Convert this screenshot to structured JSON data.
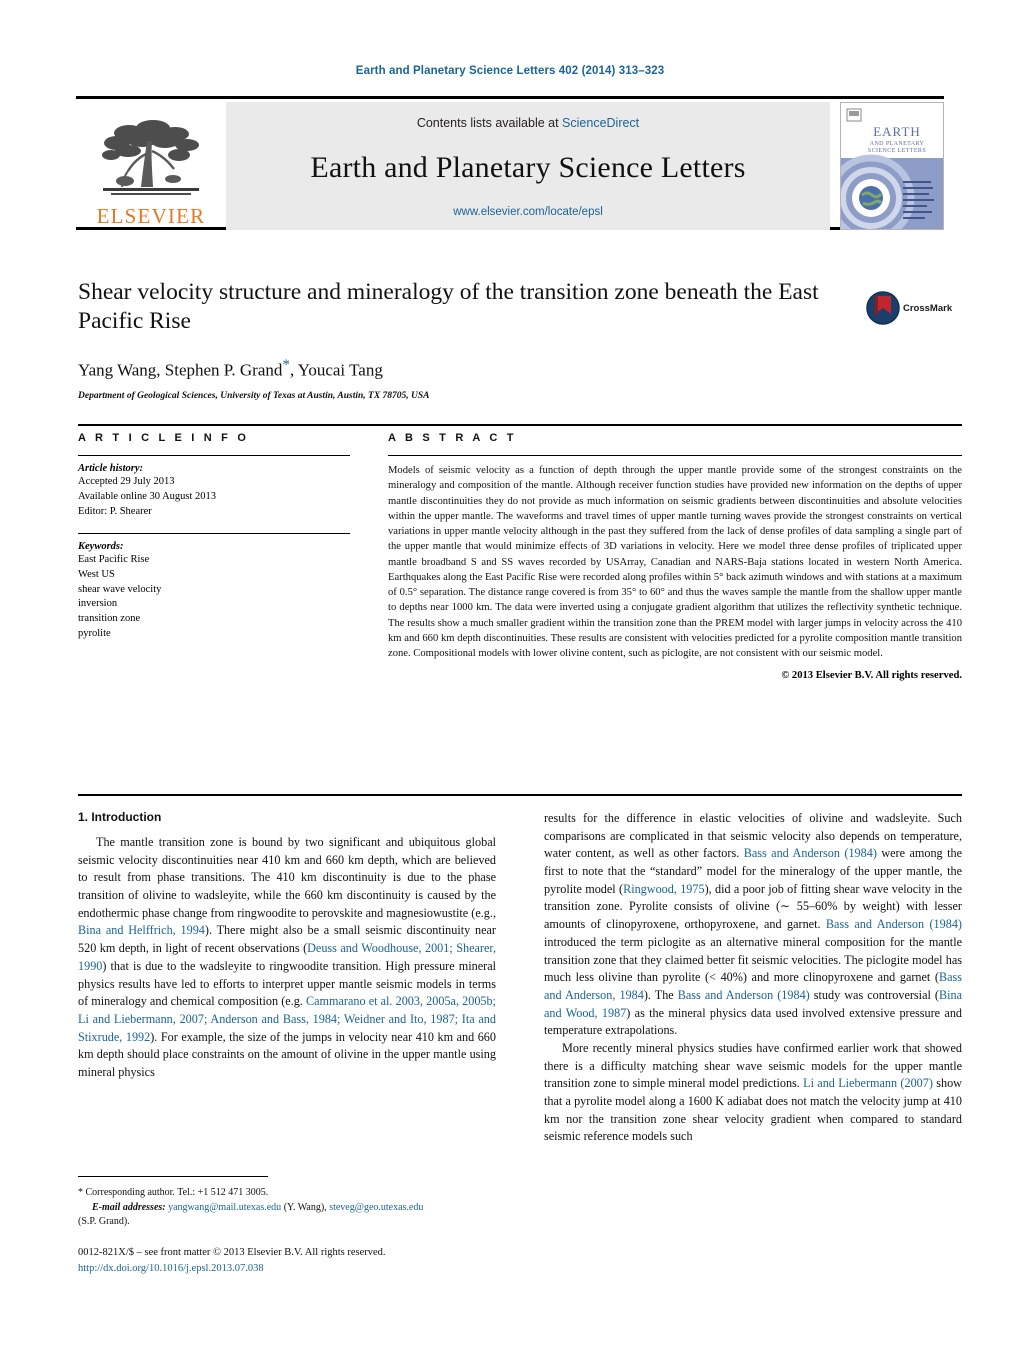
{
  "running_head": "Earth and Planetary Science Letters 402 (2014) 313–323",
  "masthead": {
    "publisher": "ELSEVIER",
    "contents_prefix": "Contents lists available at ",
    "sciencedirect": "ScienceDirect",
    "journal_title": "Earth and Planetary Science Letters",
    "journal_url": "www.elsevier.com/locate/epsl",
    "cover_title_line1": "EARTH",
    "cover_title_line2": "AND PLANETARY",
    "cover_title_line3": "SCIENCE LETTERS"
  },
  "article": {
    "title": "Shear velocity structure and mineralogy of the transition zone beneath the East Pacific Rise",
    "authors": "Yang Wang, Stephen P. Grand",
    "authors_tail": ", Youcai Tang",
    "corresponding_marker": "*",
    "affiliation": "Department of Geological Sciences, University of Texas at Austin, Austin, TX 78705, USA",
    "crossmark_label": "CrossMark"
  },
  "info": {
    "heading": "A R T I C L E    I N F O",
    "history_label": "Article history:",
    "history": [
      "Accepted 29 July 2013",
      "Available online 30 August 2013",
      "Editor: P. Shearer"
    ],
    "keywords_label": "Keywords:",
    "keywords": [
      "East Pacific Rise",
      "West US",
      "shear wave velocity",
      "inversion",
      "transition zone",
      "pyrolite"
    ]
  },
  "abstract": {
    "heading": "A B S T R A C T",
    "text": "Models of seismic velocity as a function of depth through the upper mantle provide some of the strongest constraints on the mineralogy and composition of the mantle. Although receiver function studies have provided new information on the depths of upper mantle discontinuities they do not provide as much information on seismic gradients between discontinuities and absolute velocities within the upper mantle. The waveforms and travel times of upper mantle turning waves provide the strongest constraints on vertical variations in upper mantle velocity although in the past they suffered from the lack of dense profiles of data sampling a single part of the upper mantle that would minimize effects of 3D variations in velocity. Here we model three dense profiles of triplicated upper mantle broadband S and SS waves recorded by USArray, Canadian and NARS-Baja stations located in western North America. Earthquakes along the East Pacific Rise were recorded along profiles within 5° back azimuth windows and with stations at a maximum of 0.5° separation. The distance range covered is from 35° to 60° and thus the waves sample the mantle from the shallow upper mantle to depths near 1000 km. The data were inverted using a conjugate gradient algorithm that utilizes the reflectivity synthetic technique. The results show a much smaller gradient within the transition zone than the PREM model with larger jumps in velocity across the 410 km and 660 km depth discontinuities. These results are consistent with velocities predicted for a pyrolite composition mantle transition zone. Compositional models with lower olivine content, such as piclogite, are not consistent with our seismic model.",
    "copyright": "© 2013 Elsevier B.V. All rights reserved."
  },
  "body": {
    "section_heading": "1. Introduction",
    "left_paragraph_1": "The mantle transition zone is bound by two significant and ubiquitous global seismic velocity discontinuities near 410 km and 660 km depth, which are believed to result from phase transitions. The 410 km discontinuity is due to the phase transition of olivine to wadsleyite, while the 660 km discontinuity is caused by the endothermic phase change from ringwoodite to perovskite and magnesiowustite (e.g., ",
    "left_ref_1": "Bina and Helffrich, 1994",
    "left_paragraph_1b": "). There might also be a small seismic discontinuity near 520 km depth, in light of recent observations (",
    "left_ref_2": "Deuss and Woodhouse, 2001; Shearer, 1990",
    "left_paragraph_1c": ") that is due to the wadsleyite to ringwoodite transition. High pressure mineral physics results have led to efforts to interpret upper mantle seismic models in terms of mineralogy and chemical composition (e.g. ",
    "left_ref_3": "Cammarano et al. 2003, 2005a, 2005b; Li and Liebermann, 2007; Anderson and Bass, 1984; Weidner and Ito, 1987; Ita and Stixrude, 1992",
    "left_paragraph_1d": "). For example, the size of the jumps in velocity near 410 km and 660 km depth should place constraints on the amount of olivine in the upper mantle using mineral physics",
    "right_paragraph_1a": "results for the difference in elastic velocities of olivine and wadsleyite. Such comparisons are complicated in that seismic velocity also depends on temperature, water content, as well as other factors. ",
    "right_ref_1": "Bass and Anderson (1984)",
    "right_paragraph_1b": " were among the first to note that the “standard” model for the mineralogy of the upper mantle, the pyrolite model (",
    "right_ref_2": "Ringwood, 1975",
    "right_paragraph_1c": "), did a poor job of fitting shear wave velocity in the transition zone. Pyrolite consists of olivine (∼ 55–60% by weight) with lesser amounts of clinopyroxene, orthopyroxene, and garnet. ",
    "right_ref_3": "Bass and Anderson (1984)",
    "right_paragraph_1d": " introduced the term piclogite as an alternative mineral composition for the mantle transition zone that they claimed better fit seismic velocities. The piclogite model has much less olivine than pyrolite (< 40%) and more clinopyroxene and garnet (",
    "right_ref_4": "Bass and Anderson, 1984",
    "right_paragraph_1e": "). The ",
    "right_ref_5": "Bass and Anderson (1984)",
    "right_paragraph_1f": " study was controversial (",
    "right_ref_6": "Bina and Wood, 1987",
    "right_paragraph_1g": ") as the mineral physics data used involved extensive pressure and temperature extrapolations.",
    "right_paragraph_2a": "More recently mineral physics studies have confirmed earlier work that showed there is a difficulty matching shear wave seismic models for the upper mantle transition zone to simple mineral model predictions. ",
    "right_ref_7": "Li and Liebermann (2007)",
    "right_paragraph_2b": " show that a pyrolite model along a 1600 K adiabat does not match the velocity jump at 410 km nor the transition zone shear velocity gradient when compared to standard seismic reference models such"
  },
  "footnote": {
    "marker": "*",
    "corresponding": "Corresponding author. Tel.: +1 512 471 3005.",
    "email_label": "E-mail addresses:",
    "email_1": "yangwang@mail.utexas.edu",
    "email_1_who": " (Y. Wang), ",
    "email_2": "steveg@geo.utexas.edu",
    "email_2_who": "(S.P. Grand)."
  },
  "imprint": {
    "line1": "0012-821X/$ – see front matter  © 2013 Elsevier B.V. All rights reserved.",
    "doi": "http://dx.doi.org/10.1016/j.epsl.2013.07.038"
  },
  "colors": {
    "link": "#1a6496",
    "elsevier_orange": "#E87722",
    "crossmark_blue": "#1b3f6b",
    "crossmark_red": "#c0272d",
    "masthead_grey": "#eaeaea"
  }
}
